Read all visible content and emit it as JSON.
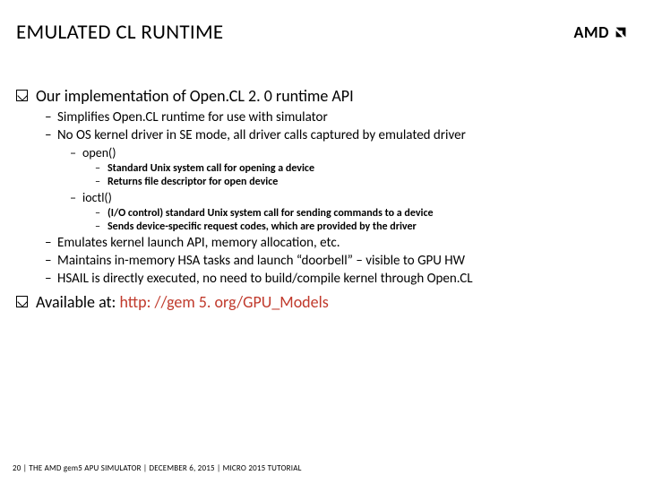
{
  "title": "EMULATED CL RUNTIME",
  "logo": {
    "text": "AMD",
    "mark_name": "amd-arrow-mark"
  },
  "bullets": {
    "l1a": "Our implementation of Open.CL 2. 0 runtime API",
    "l2a": "Simplifies Open.CL runtime for use with simulator",
    "l2b": "No OS kernel driver in SE mode, all driver calls captured by emulated driver",
    "l3a": "open()",
    "l4a": "Standard Unix system call for opening a device",
    "l4b": "Returns file descriptor for open device",
    "l3b": "ioctl()",
    "l4c": "(I/O control) standard Unix system call for sending commands to a device",
    "l4d": "Sends device-specific request codes, which are provided by the driver",
    "l2c": "Emulates kernel launch API, memory allocation, etc.",
    "l2d": "Maintains in-memory HSA tasks and launch “doorbell” – visible to GPU HW",
    "l2e": "HSAIL is directly executed, no need to build/compile kernel through Open.CL",
    "l1b_prefix": "Available at: ",
    "l1b_link": "http: //gem 5. org/GPU_Models"
  },
  "footer": {
    "page_no": "20",
    "sep": "  |  ",
    "part1": "THE AMD gem5 APU SIMULATOR",
    "part2": "DECEMBER 6, 2015",
    "part3": "MICRO 2015 TUTORIAL"
  }
}
